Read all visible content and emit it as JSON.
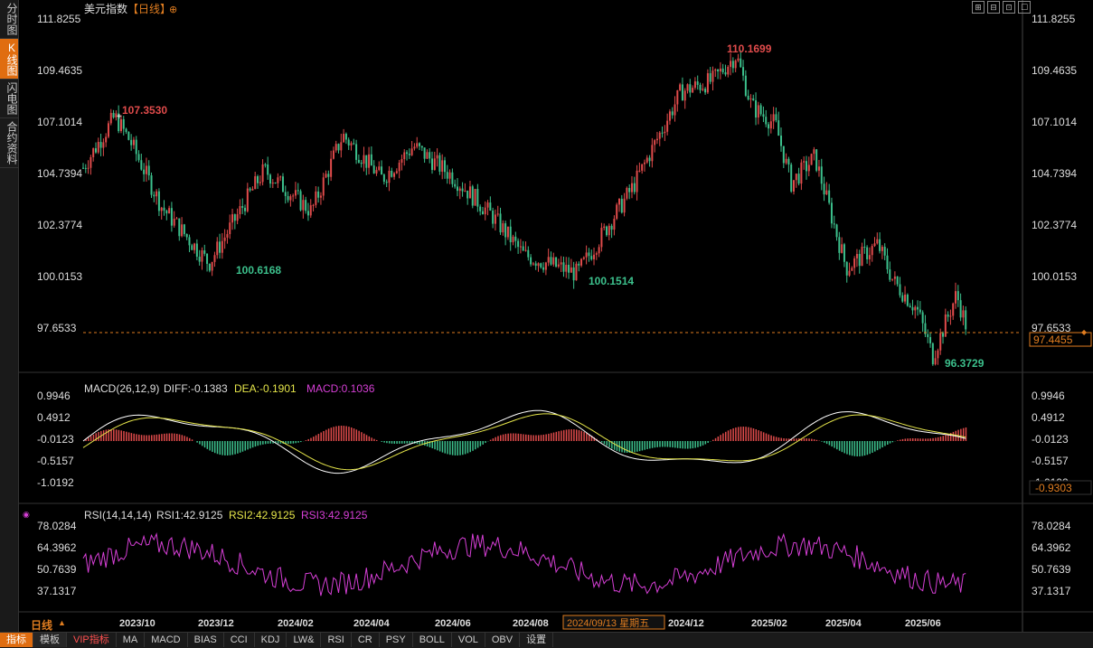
{
  "sidebar": {
    "tabs": [
      {
        "label": "分时图",
        "active": false
      },
      {
        "label": "K线图",
        "active": true
      },
      {
        "label": "闪电图",
        "active": false
      },
      {
        "label": "合约资料",
        "active": false
      }
    ]
  },
  "header": {
    "title": "美元指数",
    "period": "【日线】",
    "settings_icon": "⊕"
  },
  "tools": [
    "⊞",
    "⊟",
    "⊡",
    "☐"
  ],
  "price_axis": [
    "111.8255",
    "109.4635",
    "107.1014",
    "104.7394",
    "102.3774",
    "100.0153",
    "97.6533"
  ],
  "current_price": "97.4455",
  "annotations": {
    "high_mid": "107.3530",
    "low_mid1": "100.6168",
    "low_mid2": "100.1514",
    "top": "110.1699",
    "bottom": "96.3729"
  },
  "macd": {
    "title": "MACD(26,12,9)",
    "diff": "DIFF:-0.1383",
    "dea": "DEA:-0.1901",
    "macd": "MACD:0.1036",
    "axis": [
      "0.9946",
      "0.4912",
      "-0.0123",
      "-0.5157",
      "-1.0192"
    ],
    "current": "-0.9303"
  },
  "rsi": {
    "title": "RSI(14,14,14)",
    "rsi1": "RSI1:42.9125",
    "rsi2": "RSI2:42.9125",
    "rsi3": "RSI3:42.9125",
    "axis": [
      "78.0284",
      "64.3962",
      "50.7639",
      "37.1317"
    ]
  },
  "time_axis": [
    "2023/10",
    "2023/12",
    "2024/02",
    "2024/04",
    "2024/06",
    "2024/08",
    "2024/12",
    "2025/02",
    "2025/04",
    "2025/06"
  ],
  "cursor_date": "2024/09/13 星期五",
  "period_label": "日线",
  "bottom_tabs": [
    {
      "label": "指标",
      "active": true
    },
    {
      "label": "模板"
    },
    {
      "label": "VIP指标",
      "vip": true
    },
    {
      "label": "MA"
    },
    {
      "label": "MACD"
    },
    {
      "label": "BIAS"
    },
    {
      "label": "CCI"
    },
    {
      "label": "KDJ"
    },
    {
      "label": "LW&"
    },
    {
      "label": "RSI"
    },
    {
      "label": "CR"
    },
    {
      "label": "PSY"
    },
    {
      "label": "BOLL"
    },
    {
      "label": "VOL"
    },
    {
      "label": "OBV"
    },
    {
      "label": "设置"
    }
  ],
  "colors": {
    "up": "#e04b4b",
    "down": "#3cc08c",
    "accent": "#e06d10",
    "macd_dea": "#e5e54a",
    "rsi": "#d63fd6",
    "dashed": "#e07d20"
  },
  "chart_data": {
    "type": "candlestick",
    "price_range": [
      96.3729,
      111.8255
    ],
    "key_points": [
      {
        "label": "high",
        "date": "2023/10",
        "value": 107.353
      },
      {
        "label": "low",
        "date": "2023/12",
        "value": 100.6168
      },
      {
        "label": "low",
        "date": "2024/09",
        "value": 100.1514
      },
      {
        "label": "high",
        "date": "2025/01",
        "value": 110.1699
      },
      {
        "label": "low",
        "date": "2025/07",
        "value": 96.3729
      }
    ],
    "last_price": 97.4455
  }
}
